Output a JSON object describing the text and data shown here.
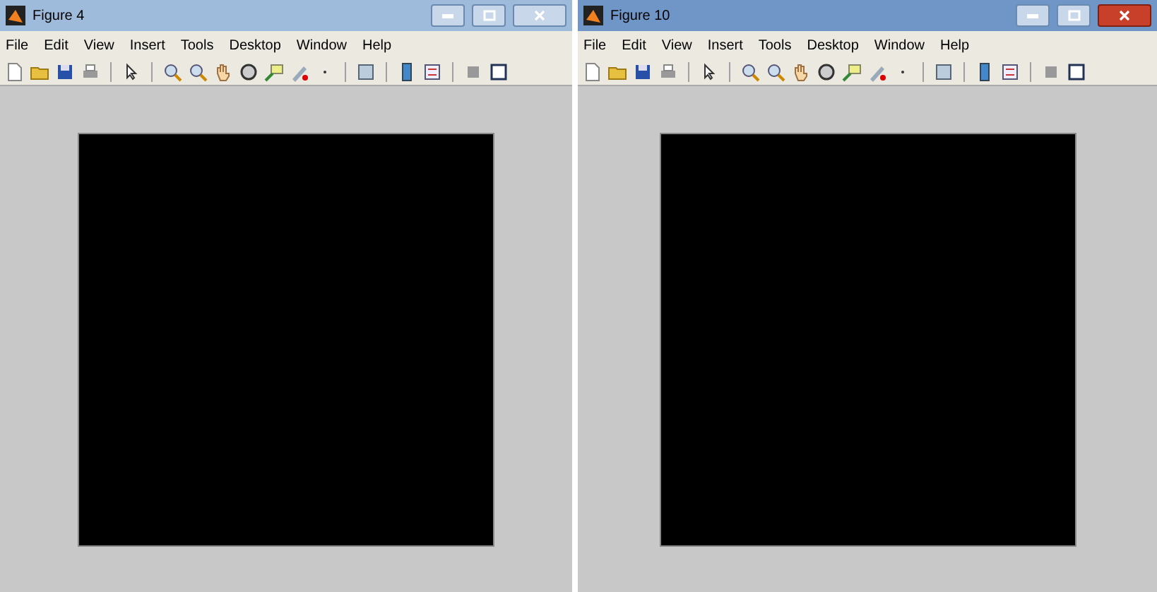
{
  "windows": [
    {
      "title": "Figure 4",
      "active": false,
      "menu": [
        "File",
        "Edit",
        "View",
        "Insert",
        "Tools",
        "Desktop",
        "Window",
        "Help"
      ]
    },
    {
      "title": "Figure 10",
      "active": true,
      "menu": [
        "File",
        "Edit",
        "View",
        "Insert",
        "Tools",
        "Desktop",
        "Window",
        "Help"
      ]
    }
  ]
}
